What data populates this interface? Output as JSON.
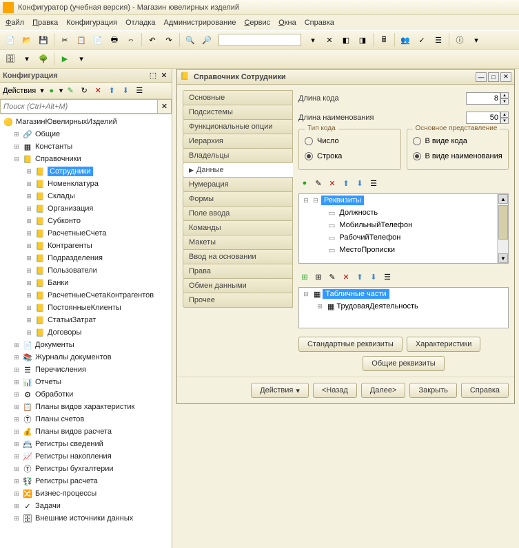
{
  "title": "Конфигуратор (учебная версия) - Магазин ювелирных изделий",
  "menu": [
    "Файл",
    "Правка",
    "Конфигурация",
    "Отладка",
    "Администрирование",
    "Сервис",
    "Окна",
    "Справка"
  ],
  "leftPanel": {
    "title": "Конфигурация",
    "actions": "Действия",
    "searchPlaceholder": "Поиск (Ctrl+Alt+M)"
  },
  "tree": {
    "root": "МагазинЮвелирныхИзделий",
    "items": [
      {
        "label": "Общие",
        "icon": "common"
      },
      {
        "label": "Константы",
        "icon": "const"
      },
      {
        "label": "Справочники",
        "icon": "ref",
        "expanded": true,
        "children": [
          {
            "label": "Сотрудники",
            "selected": true
          },
          {
            "label": "Номенклатура"
          },
          {
            "label": "Склады"
          },
          {
            "label": "Организация"
          },
          {
            "label": "Субконто"
          },
          {
            "label": "РасчетныеСчета"
          },
          {
            "label": "Контрагенты"
          },
          {
            "label": "Подразделения"
          },
          {
            "label": "Пользователи"
          },
          {
            "label": "Банки"
          },
          {
            "label": "РасчетныеСчетаКонтрагентов"
          },
          {
            "label": "ПостоянныеКлиенты"
          },
          {
            "label": "СтатьиЗатрат"
          },
          {
            "label": "Договоры"
          }
        ]
      },
      {
        "label": "Документы",
        "icon": "doc"
      },
      {
        "label": "Журналы документов",
        "icon": "journal"
      },
      {
        "label": "Перечисления",
        "icon": "enum"
      },
      {
        "label": "Отчеты",
        "icon": "report"
      },
      {
        "label": "Обработки",
        "icon": "proc"
      },
      {
        "label": "Планы видов характеристик",
        "icon": "plan"
      },
      {
        "label": "Планы счетов",
        "icon": "plan2"
      },
      {
        "label": "Планы видов расчета",
        "icon": "plan3"
      },
      {
        "label": "Регистры сведений",
        "icon": "reg"
      },
      {
        "label": "Регистры накопления",
        "icon": "reg2"
      },
      {
        "label": "Регистры бухгалтерии",
        "icon": "reg3"
      },
      {
        "label": "Регистры расчета",
        "icon": "reg4"
      },
      {
        "label": "Бизнес-процессы",
        "icon": "bp"
      },
      {
        "label": "Задачи",
        "icon": "task"
      },
      {
        "label": "Внешние источники данных",
        "icon": "ext"
      }
    ]
  },
  "dialog": {
    "title": "Справочник Сотрудники",
    "tabs": [
      "Основные",
      "Подсистемы",
      "Функциональные опции",
      "Иерархия",
      "Владельцы",
      "Данные",
      "Нумерация",
      "Формы",
      "Поле ввода",
      "Команды",
      "Макеты",
      "Ввод на основании",
      "Права",
      "Обмен данными",
      "Прочее"
    ],
    "activeTab": "Данные",
    "fields": {
      "codeLenLabel": "Длина кода",
      "codeLen": "8",
      "nameLenLabel": "Длина наименования",
      "nameLen": "50"
    },
    "codeType": {
      "title": "Тип кода",
      "opts": [
        "Число",
        "Строка"
      ],
      "sel": "Строка"
    },
    "mainRep": {
      "title": "Основное представление",
      "opts": [
        "В виде кода",
        "В виде наименования"
      ],
      "sel": "В виде наименования"
    },
    "attrs": {
      "root": "Реквизиты",
      "items": [
        "Должность",
        "МобильныйТелефон",
        "РабочийТелефон",
        "МестоПрописки"
      ]
    },
    "tabs2": {
      "root": "Табличные части",
      "items": [
        "ТрудоваяДеятельность"
      ]
    },
    "btns": {
      "std": "Стандартные реквизиты",
      "char": "Характеристики",
      "common": "Общие реквизиты"
    },
    "footer": {
      "actions": "Действия",
      "back": "<Назад",
      "next": "Далее>",
      "close": "Закрыть",
      "help": "Справка"
    }
  }
}
